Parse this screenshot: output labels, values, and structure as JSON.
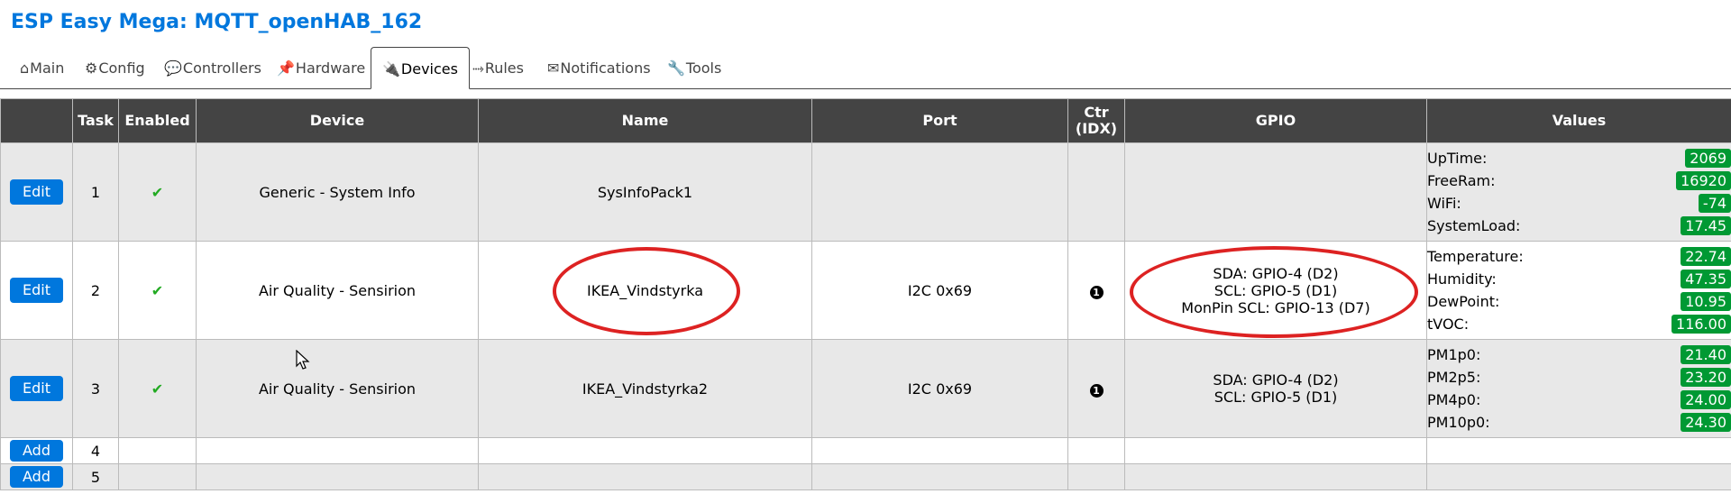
{
  "header": {
    "title": "ESP Easy Mega: MQTT_openHAB_162"
  },
  "menu": [
    {
      "icon": "⌂",
      "icon_name": "home-icon",
      "label": "Main"
    },
    {
      "icon": "⚙",
      "icon_name": "gear-icon",
      "label": "Config"
    },
    {
      "icon": "💬",
      "icon_name": "chat-icon",
      "label": "Controllers"
    },
    {
      "icon": "📌",
      "icon_name": "pin-icon",
      "label": "Hardware"
    },
    {
      "icon": "🔌",
      "icon_name": "plug-icon",
      "label": "Devices"
    },
    {
      "icon": "⤑",
      "icon_name": "arrow-icon",
      "label": "Rules"
    },
    {
      "icon": "✉",
      "icon_name": "envelope-icon",
      "label": "Notifications"
    },
    {
      "icon": "🔧",
      "icon_name": "wrench-icon",
      "label": "Tools"
    }
  ],
  "active_tab": "Devices",
  "table": {
    "headers": {
      "task": "Task",
      "enabled": "Enabled",
      "device": "Device",
      "name": "Name",
      "port": "Port",
      "ctr_line1": "Ctr",
      "ctr_line2": "(IDX)",
      "gpio": "GPIO",
      "values": "Values"
    },
    "rows": [
      {
        "button": "Edit",
        "task": "1",
        "enabled": "✔",
        "device": "Generic - System Info",
        "name": "SysInfoPack1",
        "port": "",
        "ctr": "",
        "gpio": [],
        "values": [
          {
            "name": "UpTime:",
            "value": "2069"
          },
          {
            "name": "FreeRam:",
            "value": "16920"
          },
          {
            "name": "WiFi:",
            "value": "-74"
          },
          {
            "name": "SystemLoad:",
            "value": "17.45"
          }
        ]
      },
      {
        "button": "Edit",
        "task": "2",
        "enabled": "✔",
        "device": "Air Quality - Sensirion",
        "name": "IKEA_Vindstyrka",
        "port": "I2C 0x69",
        "ctr": "1",
        "gpio": [
          "SDA: GPIO-4 (D2)",
          "SCL: GPIO-5 (D1)",
          "MonPin SCL: GPIO-13 (D7)"
        ],
        "values": [
          {
            "name": "Temperature:",
            "value": "22.74"
          },
          {
            "name": "Humidity:",
            "value": "47.35"
          },
          {
            "name": "DewPoint:",
            "value": "10.95"
          },
          {
            "name": "tVOC:",
            "value": "116.00"
          }
        ]
      },
      {
        "button": "Edit",
        "task": "3",
        "enabled": "✔",
        "device": "Air Quality - Sensirion",
        "name": "IKEA_Vindstyrka2",
        "port": "I2C 0x69",
        "ctr": "1",
        "gpio": [
          "SDA: GPIO-4 (D2)",
          "SCL: GPIO-5 (D1)"
        ],
        "values": [
          {
            "name": "PM1p0:",
            "value": "21.40"
          },
          {
            "name": "PM2p5:",
            "value": "23.20"
          },
          {
            "name": "PM4p0:",
            "value": "24.00"
          },
          {
            "name": "PM10p0:",
            "value": "24.30"
          }
        ]
      },
      {
        "button": "Add",
        "task": "4"
      },
      {
        "button": "Add",
        "task": "5"
      }
    ]
  },
  "colors": {
    "accent": "#0077DD",
    "header_bg": "#444444",
    "value_badge": "#009933",
    "annotation": "#DD2222"
  }
}
